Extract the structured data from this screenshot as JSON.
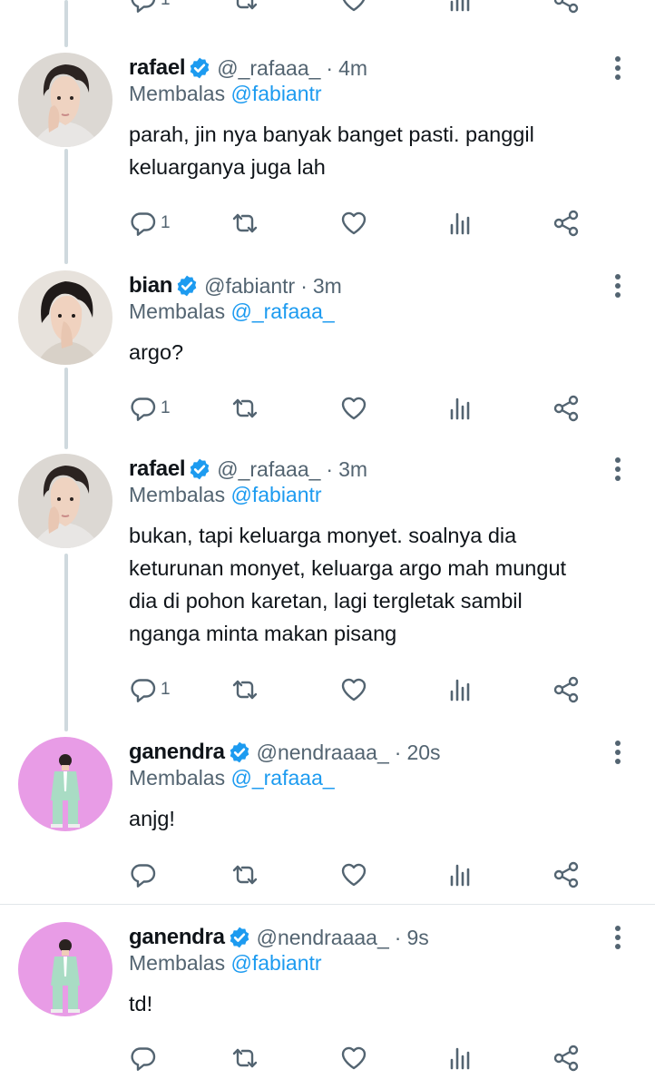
{
  "colors": {
    "accent": "#1d9bf0",
    "muted": "#536471",
    "text": "#0f1419",
    "thread_line": "#cfd9de",
    "divider": "#e1e6ea"
  },
  "reply_prefix": "Membalas",
  "top_actions": {
    "reply_count": "1"
  },
  "tweets": [
    {
      "name": "rafael",
      "handle": "@_rafaaa_",
      "time": "4m",
      "reply_to": "@fabiantr",
      "lines": [
        "parah, jin nya banyak banget pasti. panggil",
        "keluarganya juga lah"
      ],
      "reply_count": "1",
      "avatar": "rafael-avatar"
    },
    {
      "name": "bian",
      "handle": "@fabiantr",
      "time": "3m",
      "reply_to": "@_rafaaa_",
      "lines": [
        "argo?"
      ],
      "reply_count": "1",
      "avatar": "bian-avatar"
    },
    {
      "name": "rafael",
      "handle": "@_rafaaa_",
      "time": "3m",
      "reply_to": "@fabiantr",
      "lines": [
        "bukan, tapi keluarga monyet. soalnya dia",
        "keturunan monyet, keluarga argo mah mungut",
        "dia di pohon karetan, lagi tergletak sambil",
        "nganga minta makan pisang"
      ],
      "reply_count": "1",
      "avatar": "rafael-avatar"
    },
    {
      "name": "ganendra",
      "handle": "@nendraaaa_",
      "time": "20s",
      "reply_to": "@_rafaaa_",
      "lines": [
        "anjg!"
      ],
      "reply_count": "",
      "avatar": "ganendra-avatar"
    },
    {
      "name": "ganendra",
      "handle": "@nendraaaa_",
      "time": "9s",
      "reply_to": "@fabiantr",
      "lines": [
        "td!"
      ],
      "reply_count": "",
      "avatar": "ganendra-avatar"
    }
  ]
}
